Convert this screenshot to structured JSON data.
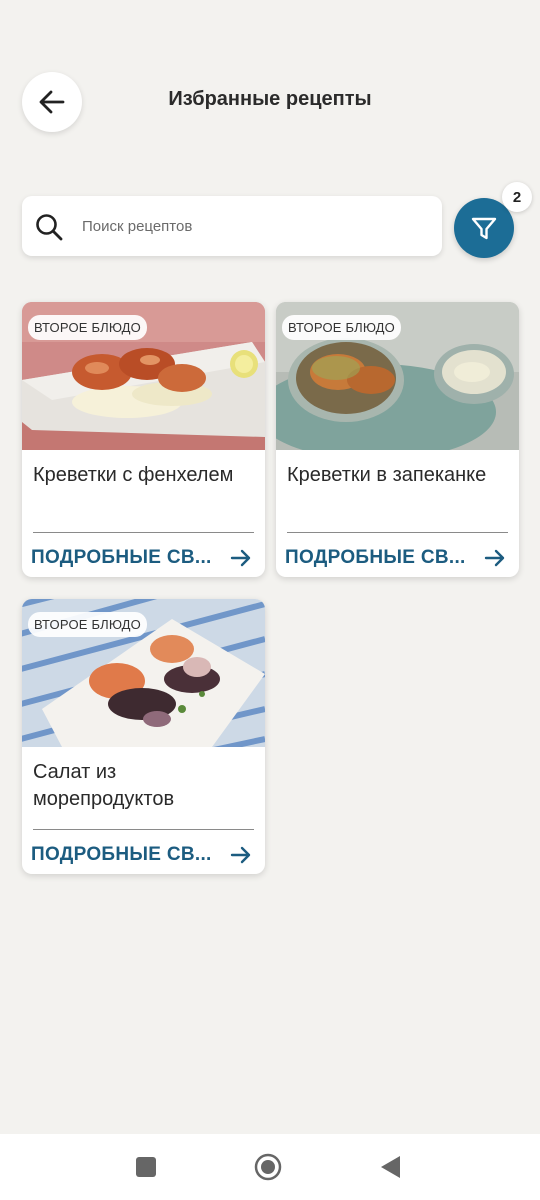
{
  "header": {
    "title": "Избранные рецепты",
    "back_icon": "arrow-left-icon"
  },
  "search": {
    "placeholder": "Поиск рецептов",
    "value": "",
    "icon": "search-icon"
  },
  "filter": {
    "icon": "filter-icon",
    "badge_count": "2",
    "color": "#1c6d96"
  },
  "recipes": [
    {
      "category": "ВТОРОЕ БЛЮДО",
      "title": "Креветки с фенхелем",
      "link_label": "ПОДРОБНЫЕ СВ...",
      "image": "shrimp-with-fennel-photo"
    },
    {
      "category": "ВТОРОЕ БЛЮДО",
      "title": "Креветки в запеканке",
      "link_label": "ПОДРОБНЫЕ СВ...",
      "image": "baked-shrimp-photo"
    },
    {
      "category": "ВТОРОЕ БЛЮДО",
      "title": "Салат из морепродуктов",
      "link_label": "ПОДРОБНЫЕ СВ...",
      "image": "seafood-salad-photo"
    }
  ],
  "colors": {
    "background": "#f3f2ef",
    "accent": "#1c5c80",
    "card": "#ffffff"
  },
  "navbar": {
    "items": [
      "recent-apps-icon",
      "home-icon",
      "back-icon"
    ]
  }
}
